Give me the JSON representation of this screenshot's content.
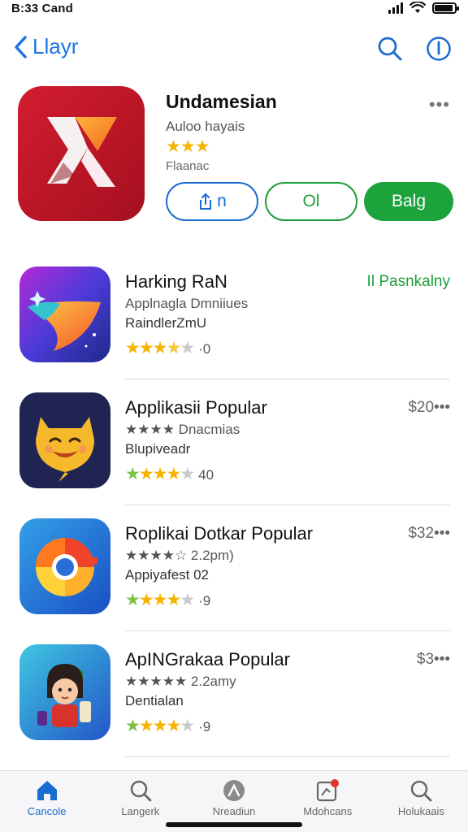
{
  "status": {
    "time": "B:33 Cand",
    "signal_icon": "signal-icon",
    "wifi_icon": "wifi-icon",
    "battery_icon": "battery-icon"
  },
  "nav": {
    "back_label": "Llayr",
    "search_icon": "search-icon",
    "info_icon": "info-icon"
  },
  "hero": {
    "title": "Undamesian",
    "subtitle": "Auloo hayais",
    "stars": "★★★",
    "category": "Flaanac",
    "more_label": "•••",
    "buttons": [
      {
        "label": "n",
        "style": "outline-blue"
      },
      {
        "label": "Ol",
        "style": "outline-green"
      },
      {
        "label": "Balg",
        "style": "filled-green"
      }
    ]
  },
  "list": [
    {
      "title": "Harking RaN",
      "line1": "Applnagla Dmniiues",
      "line2": "RaindlerZmU",
      "rating_text": "·0",
      "price": "Il Pasnkalny",
      "price_color": "#1e9e3a"
    },
    {
      "title": "Applikasii Popular",
      "line1": "★★★★ Dnacmias",
      "line2": "Blupiveadr",
      "rating_text": "40",
      "price": "$20•••",
      "price_color": "#666666"
    },
    {
      "title": "Roplikai Dotkar Popular",
      "line1": "★★★★☆ 2.2pm)",
      "line2": "Appiyafest 02",
      "rating_text": "·9",
      "price": "$32•••",
      "price_color": "#666666"
    },
    {
      "title": "ApINGrakaa Popular",
      "line1": "★★★★★ 2.2amy",
      "line2": "Dentialan",
      "rating_text": "·9",
      "price": "$3•••",
      "price_color": "#666666"
    }
  ],
  "tabs": [
    {
      "label": "Cancole",
      "icon": "home-icon",
      "active": true
    },
    {
      "label": "Langerk",
      "icon": "search-icon",
      "active": false
    },
    {
      "label": "Nreadiun",
      "icon": "maps-icon",
      "active": false
    },
    {
      "label": "Mdohcans",
      "icon": "notifications-icon",
      "active": false
    },
    {
      "label": "Holukaais",
      "icon": "search-icon",
      "active": false
    }
  ],
  "colors": {
    "accent_blue": "#1a6ccf",
    "accent_green": "#1ca33c",
    "star_yellow": "#f5b400",
    "star_green": "#7bc043"
  }
}
